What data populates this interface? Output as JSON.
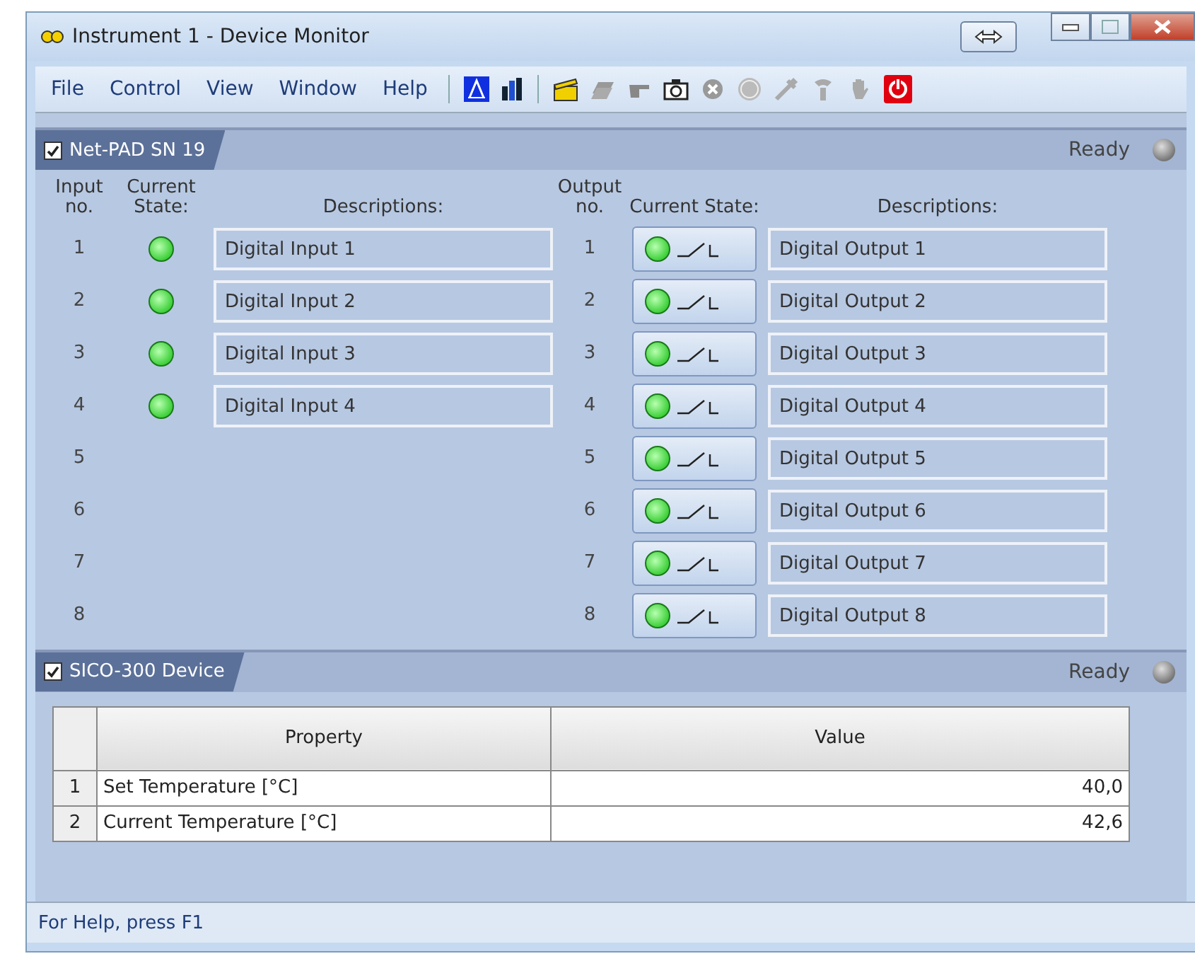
{
  "window": {
    "title": "Instrument 1 - Device Monitor"
  },
  "menu": [
    "File",
    "Control",
    "View",
    "Window",
    "Help"
  ],
  "netpad": {
    "title": "Net-PAD SN 19",
    "checked": true,
    "status": "Ready",
    "input_headers": {
      "number": "Input no.",
      "state": "Current State:",
      "description": "Descriptions:"
    },
    "output_headers": {
      "number": "Output no.",
      "state": "Current State:",
      "description": "Descriptions:"
    },
    "inputs": [
      {
        "number": "1",
        "on": true,
        "description": "Digital Input 1"
      },
      {
        "number": "2",
        "on": true,
        "description": "Digital Input 2"
      },
      {
        "number": "3",
        "on": true,
        "description": "Digital Input 3"
      },
      {
        "number": "4",
        "on": true,
        "description": "Digital Input 4"
      },
      {
        "number": "5"
      },
      {
        "number": "6"
      },
      {
        "number": "7"
      },
      {
        "number": "8"
      }
    ],
    "outputs": [
      {
        "number": "1",
        "on": true,
        "description": "Digital Output 1"
      },
      {
        "number": "2",
        "on": true,
        "description": "Digital Output 2"
      },
      {
        "number": "3",
        "on": true,
        "description": "Digital Output 3"
      },
      {
        "number": "4",
        "on": true,
        "description": "Digital Output 4"
      },
      {
        "number": "5",
        "on": true,
        "description": "Digital Output 5"
      },
      {
        "number": "6",
        "on": true,
        "description": "Digital Output 6"
      },
      {
        "number": "7",
        "on": true,
        "description": "Digital Output 7"
      },
      {
        "number": "8",
        "on": true,
        "description": "Digital Output 8"
      }
    ]
  },
  "sico": {
    "title": "SICO-300 Device",
    "checked": true,
    "status": "Ready",
    "table": {
      "columns": [
        "Property",
        "Value"
      ],
      "rows": [
        {
          "index": "1",
          "property": "Set Temperature [°C]",
          "value": "40,0"
        },
        {
          "index": "2",
          "property": "Current Temperature [°C]",
          "value": "42,6"
        }
      ]
    }
  },
  "status_bar": "For Help, press F1"
}
